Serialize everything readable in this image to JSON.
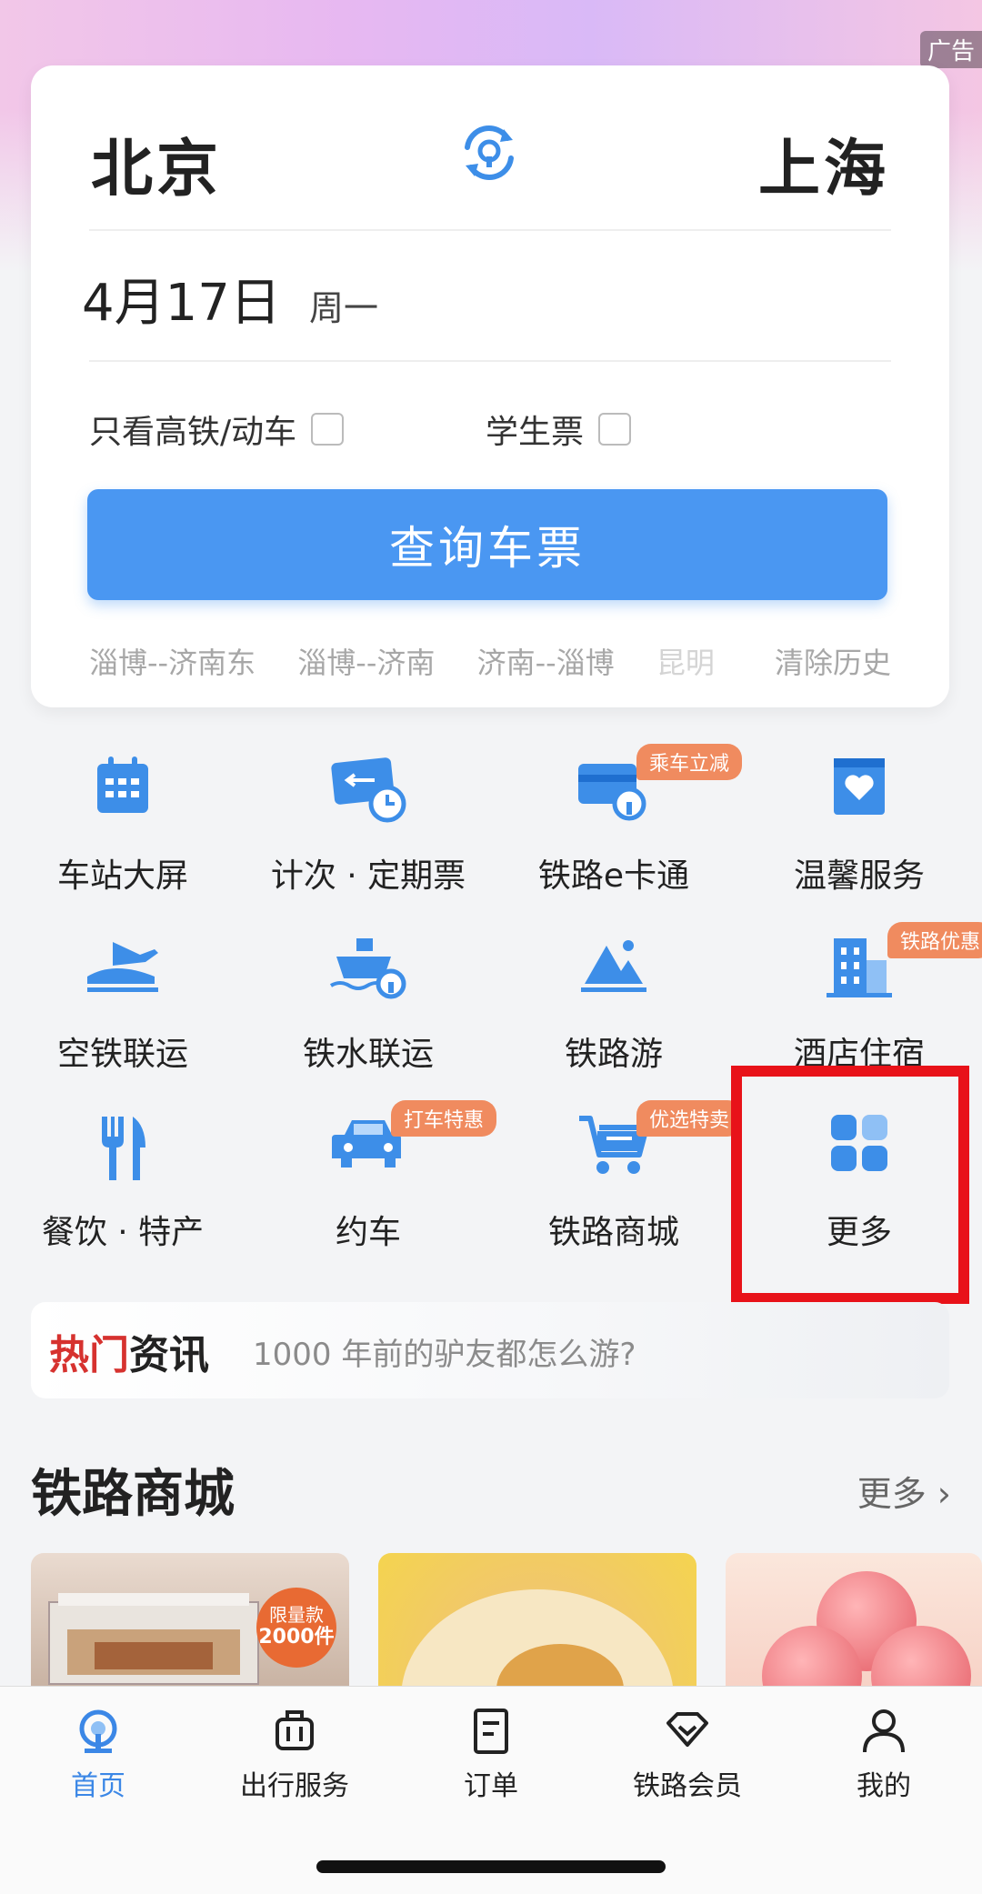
{
  "banner": {
    "ad_label": "广告"
  },
  "search": {
    "from_city": "北京",
    "to_city": "上海",
    "date": "4月17日",
    "weekday": "周一",
    "option_highspeed": "只看高铁/动车",
    "option_student": "学生票",
    "search_button": "查询车票",
    "history": [
      "淄博--济南东",
      "淄博--济南",
      "济南--淄博",
      "昆明"
    ],
    "clear_history": "清除历史"
  },
  "grid": [
    {
      "label": "车站大屏",
      "icon": "station-screen-icon"
    },
    {
      "label": "计次 · 定期票",
      "icon": "period-ticket-icon"
    },
    {
      "label": "铁路e卡通",
      "icon": "ecard-icon",
      "tag": "乘车立减"
    },
    {
      "label": "温馨服务",
      "icon": "care-service-icon"
    },
    {
      "label": "空铁联运",
      "icon": "air-rail-icon"
    },
    {
      "label": "铁水联运",
      "icon": "rail-water-icon"
    },
    {
      "label": "铁路游",
      "icon": "rail-tour-icon"
    },
    {
      "label": "酒店住宿",
      "icon": "hotel-icon",
      "tag": "铁路优惠"
    },
    {
      "label": "餐饮 · 特产",
      "icon": "dining-icon"
    },
    {
      "label": "约车",
      "icon": "car-icon",
      "tag": "打车特惠"
    },
    {
      "label": "铁路商城",
      "icon": "mall-cart-icon",
      "tag": "优选特卖"
    },
    {
      "label": "更多",
      "icon": "more-grid-icon"
    }
  ],
  "news": {
    "title_part1": "热门",
    "title_part2": "资讯",
    "text": "1000 年前的驴友都怎么游?"
  },
  "mall": {
    "title": "铁路商城",
    "more": "更多 ›",
    "badge_line1": "限量款",
    "badge_line2": "2000件"
  },
  "tabs": [
    {
      "label": "首页",
      "active": true
    },
    {
      "label": "出行服务"
    },
    {
      "label": "订单"
    },
    {
      "label": "铁路会员"
    },
    {
      "label": "我的"
    }
  ],
  "colors": {
    "primary": "#4a97f2",
    "tag": "#f08b5f",
    "highlight": "#e81219",
    "active_tab": "#3b87e6"
  }
}
